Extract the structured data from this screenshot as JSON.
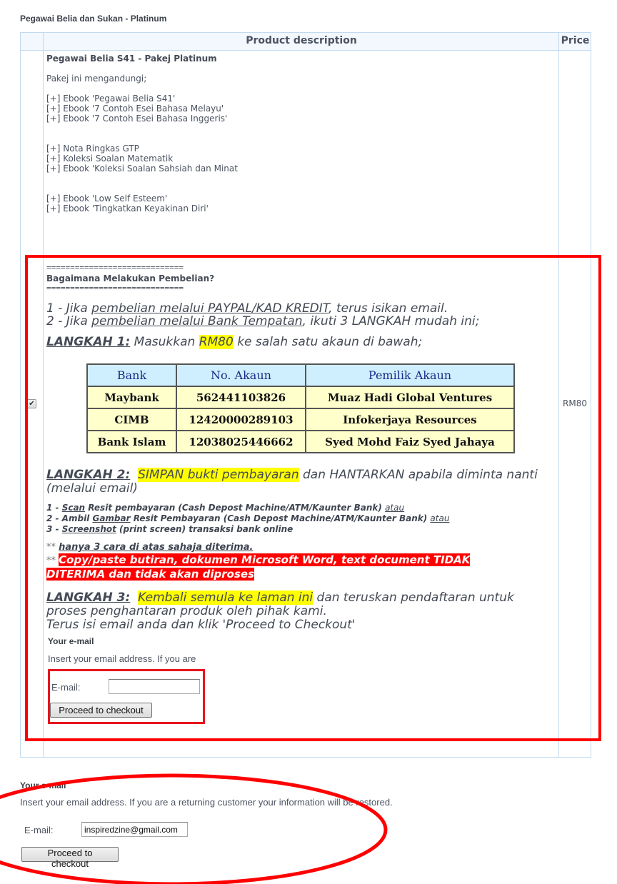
{
  "section_title": "Pegawai Belia dan Sukan - Platinum",
  "table": {
    "headers": {
      "description": "Product description",
      "price": "Price"
    },
    "product": {
      "name": "Pegawai Belia S41 - Pakej Platinum",
      "contents_intro": "Pakej ini mengandungi;",
      "items": [
        "[+] Ebook 'Pegawai Belia S41'",
        "[+] Ebook '7 Contoh Esei Bahasa Melayu'",
        "[+] Ebook '7 Contoh Esei Bahasa Inggeris'",
        "[+] Nota Ringkas GTP",
        "[+] Koleksi Soalan Matematik",
        "[+] Ebook 'Koleksi Soalan Sahsiah dan Minat",
        "[+] Ebook 'Low Self Esteem'",
        "[+] Ebook 'Tingkatkan Keyakinan Diri'"
      ],
      "checkbox_checked": true,
      "checkbox_glyph": "✔",
      "price": "RM80"
    }
  },
  "instructions": {
    "divider": "=============================",
    "heading": "Bagaimana Melakukan Pembelian?",
    "option1": {
      "prefix": "1 - Jika ",
      "link": "pembelian melalui PAYPAL/KAD KREDIT",
      "suffix": ", terus isikan email."
    },
    "option2": {
      "prefix": "2 - Jika ",
      "link": "pembelian melalui Bank Tempatan",
      "suffix": ", ikuti 3 LANGKAH mudah ini;"
    },
    "step1": {
      "label": "LANGKAH 1:",
      "pre": " Masukkan ",
      "highlight": "RM80",
      "post": " ke salah satu akaun di bawah;"
    },
    "bank_table": {
      "headers": [
        "Bank",
        "No. Akaun",
        "Pemilik Akaun"
      ],
      "rows": [
        [
          "Maybank",
          "562441103826",
          "Muaz Hadi Global Ventures"
        ],
        [
          "CIMB",
          "12420000289103",
          "Infokerjaya Resources"
        ],
        [
          "Bank Islam",
          "12038025446662",
          "Syed Mohd Faiz Syed Jahaya"
        ]
      ]
    },
    "step2": {
      "label": "LANGKAH 2:",
      "highlight": "SIMPAN bukti pembayaran",
      "post": " dan HANTARKAN apabila diminta nanti",
      "post2": "(melalui email)",
      "methods": [
        {
          "num": "1 - ",
          "key": "Scan",
          "text": " Resit pembayaran (Cash Depost Machine/ATM/Kaunter Bank) ",
          "or": "atau"
        },
        {
          "num": "2 - Ambil ",
          "key": "Gambar",
          "text": " Resit Pembayaran (Cash Depost Machine/ATM/Kaunter Bank) ",
          "or": "atau"
        },
        {
          "num": "3 - ",
          "key": "Screenshot",
          "text": " (print screen) transaksi bank online",
          "or": ""
        }
      ],
      "note1_prefix": "** ",
      "note1": "hanya 3 cara di atas sahaja diterima.",
      "note2_prefix": "** ",
      "note2": "Copy/paste butiran, dokumen Microsoft Word, text document TIDAK DITERIMA dan tidak akan diproses"
    },
    "step3": {
      "label": "LANGKAH 3:",
      "highlight": "Kembali semula ke laman ini",
      "post": " dan teruskan pendaftaran untuk proses penghantaran produk oleh pihak kami.",
      "line2": "Terus isi email anda dan klik 'Proceed to Checkout'"
    },
    "embedded_form": {
      "title": "Your e-mail",
      "desc": "Insert your email address. If you are",
      "email_label": "E-mail:",
      "email_value": "",
      "button": "Proceed to checkout"
    }
  },
  "bottom_form": {
    "title": "Your e-mail",
    "desc": "Insert your email address. If you are a returning customer your information will be restored.",
    "email_label": "E-mail:",
    "email_value": "inspiredzine@gmail.com",
    "button": "Proceed to checkout"
  },
  "annotation_color": "#ff0000"
}
